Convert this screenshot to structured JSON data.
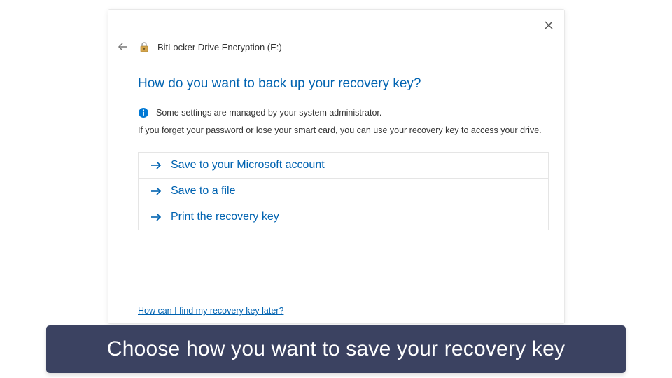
{
  "dialog": {
    "title": "BitLocker Drive Encryption (E:)",
    "heading": "How do you want to back up your recovery key?",
    "admin_notice": "Some settings are managed by your system administrator.",
    "description": "If you forget your password or lose your smart card, you can use your recovery key to access your drive.",
    "options": [
      {
        "label": "Save to your Microsoft account"
      },
      {
        "label": "Save to a file"
      },
      {
        "label": "Print the recovery key"
      }
    ],
    "help_link": "How can I find my recovery key later?"
  },
  "caption": "Choose how you want to save your recovery key"
}
